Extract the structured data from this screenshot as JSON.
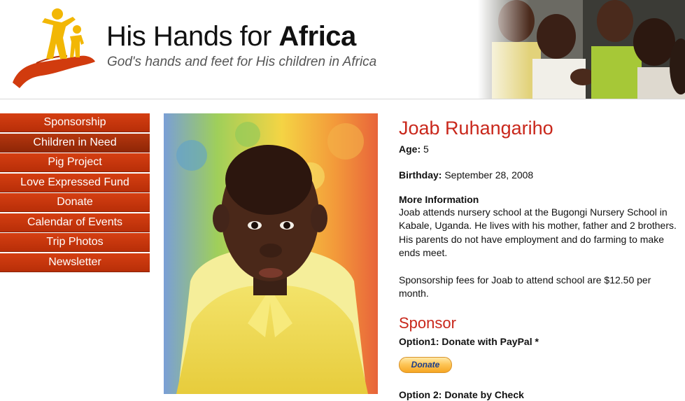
{
  "header": {
    "title_regular": "His Hands for ",
    "title_bold": "Africa",
    "tagline": "God's hands and feet for His children in Africa",
    "logo_icon": "hands-holding-family-icon",
    "photo": "children-clapping-photo"
  },
  "nav": {
    "items": [
      {
        "label": "Sponsorship"
      },
      {
        "label": "Children in Need"
      },
      {
        "label": "Pig Project"
      },
      {
        "label": "Love Expressed Fund"
      },
      {
        "label": "Donate"
      },
      {
        "label": "Calendar of Events"
      },
      {
        "label": "Trip Photos"
      },
      {
        "label": "Newsletter"
      }
    ],
    "active": "Children in Need"
  },
  "child": {
    "photo": "child-portrait-photo",
    "name": "Joab Ruhangariho",
    "age_label": "Age:",
    "age": "5",
    "birthday_label": "Birthday:",
    "birthday": "September 28, 2008",
    "more_info_label": "More Information",
    "more_info": "Joab attends nursery school at the Bugongi Nursery School in Kabale, Uganda. He lives with his mother, father and 2 brothers. His parents do not have employment and do farming to make ends meet.",
    "fees": "Sponsorship fees for Joab to attend school are $12.50 per month."
  },
  "sponsor": {
    "title": "Sponsor",
    "option1": "Option1: Donate with PayPal *",
    "donate_button": "Donate",
    "option2": "Option 2: Donate by Check"
  },
  "colors": {
    "accent_red": "#c9271b",
    "nav_red": "#c8370e",
    "logo_yellow": "#f2b705",
    "paypal_gold": "#fdc659"
  }
}
